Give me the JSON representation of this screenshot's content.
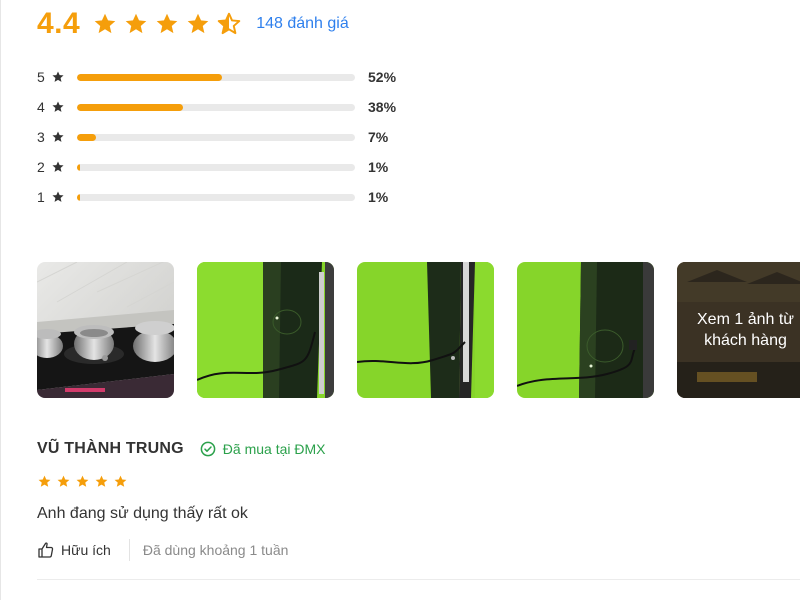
{
  "rating_summary": {
    "average": "4.4",
    "average_value": 4.4,
    "total_label": "148 đánh giá",
    "star_color": "#f59e0b",
    "stars": [
      "full",
      "full",
      "full",
      "full",
      "half"
    ]
  },
  "distribution": [
    {
      "star": "5",
      "percent_label": "52%",
      "percent": 52
    },
    {
      "star": "4",
      "percent_label": "38%",
      "percent": 38
    },
    {
      "star": "3",
      "percent_label": "7%",
      "percent": 7
    },
    {
      "star": "2",
      "percent_label": "1%",
      "percent": 1
    },
    {
      "star": "1",
      "percent_label": "1%",
      "percent": 1
    }
  ],
  "photos": {
    "thumbnails": [
      {
        "subject": "induction-cooktop-with-pots"
      },
      {
        "subject": "green-wall-black-panel"
      },
      {
        "subject": "green-wall-black-panel"
      },
      {
        "subject": "green-wall-black-panel"
      }
    ],
    "more_label": "Xem 1 ảnh từ khách hàng"
  },
  "review": {
    "name": "VŨ THÀNH TRUNG",
    "verified_label": "Đã mua tại ĐMX",
    "verified_color": "#2ba14b",
    "rating": 5,
    "text": "Anh đang sử dụng thấy rất ok",
    "like_label": "Hữu ích",
    "usage_label": "Đã dùng khoảng 1 tuần",
    "icons": [
      "check-circle-icon",
      "thumbs-up-icon",
      "star-icon"
    ]
  }
}
